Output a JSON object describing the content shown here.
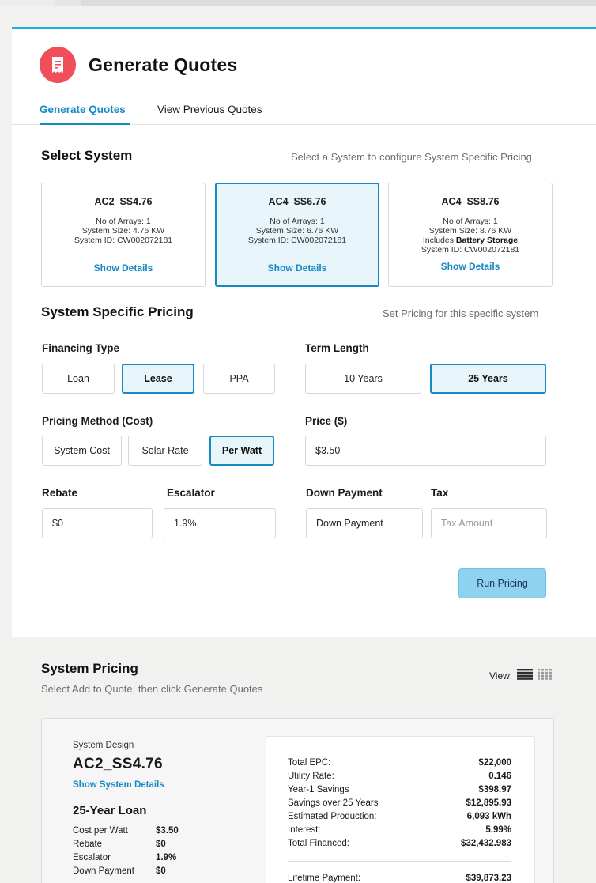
{
  "colors": {
    "accent": "#1589c4",
    "header_icon_bg": "#ef4e5a",
    "selected_bg": "#e8f6fb",
    "run_button_bg": "#8fd2f0"
  },
  "header": {
    "title": "Generate Quotes",
    "icon": "receipt-icon"
  },
  "tabs": [
    {
      "label": "Generate Quotes",
      "active": true
    },
    {
      "label": "View Previous Quotes",
      "active": false
    }
  ],
  "select_system": {
    "title": "Select System",
    "hint": "Select a System to configure System Specific Pricing",
    "systems": [
      {
        "name": "AC2_SS4.76",
        "arrays": "No of Arrays: 1",
        "size": "System Size: 4.76 KW",
        "battery_prefix": "",
        "battery_bold": "",
        "id": "System ID: CW002072181",
        "details": "Show Details",
        "selected": false
      },
      {
        "name": "AC4_SS6.76",
        "arrays": "No of Arrays: 1",
        "size": "System Size: 6.76 KW",
        "battery_prefix": "",
        "battery_bold": "",
        "id": "System ID: CW002072181",
        "details": "Show Details",
        "selected": true
      },
      {
        "name": "AC4_SS8.76",
        "arrays": "No of Arrays: 1",
        "size": "System Size: 8.76 KW",
        "battery_prefix": "Includes",
        "battery_bold": "Battery Storage",
        "id": "System ID: CW002072181",
        "details": "Show Details",
        "selected": false
      }
    ]
  },
  "pricing": {
    "title": "System Specific Pricing",
    "hint": "Set Pricing for this specific system",
    "financing_label": "Financing Type",
    "financing_options": [
      "Loan",
      "Lease",
      "PPA"
    ],
    "financing_selected": "Lease",
    "term_label": "Term Length",
    "term_options": [
      "10 Years",
      "25 Years"
    ],
    "term_selected": "25 Years",
    "method_label": "Pricing Method (Cost)",
    "method_options": [
      "System Cost",
      "Solar Rate",
      "Per Watt"
    ],
    "method_selected": "Per Watt",
    "price_label": "Price ($)",
    "price_value": "$3.50",
    "rebate_label": "Rebate",
    "rebate_value": "$0",
    "escalator_label": "Escalator",
    "escalator_value": "1.9%",
    "down_payment_label": "Down Payment",
    "down_payment_value": "Down Payment",
    "tax_label": "Tax",
    "tax_placeholder": "Tax Amount",
    "run_button": "Run Pricing"
  },
  "system_pricing": {
    "title": "System Pricing",
    "subtitle": "Select Add to Quote, then click Generate Quotes",
    "view_label": "View:",
    "result": {
      "design_label": "System Design",
      "design_name": "AC2_SS4.76",
      "details_link": "Show System Details",
      "loan_title": "25-Year Loan",
      "params": [
        {
          "k": "Cost per Watt",
          "v": "$3.50"
        },
        {
          "k": "Rebate",
          "v": "$0"
        },
        {
          "k": "Escalator",
          "v": "1.9%"
        },
        {
          "k": "Down Payment",
          "v": "$0"
        }
      ],
      "metrics": [
        {
          "k": "Total EPC:",
          "v": "$22,000"
        },
        {
          "k": "Utility Rate:",
          "v": "0.146"
        },
        {
          "k": "Year-1 Savings",
          "v": "$398.97"
        },
        {
          "k": "Savings over 25 Years",
          "v": "$12,895.93"
        },
        {
          "k": "Estimated Production:",
          "v": "6,093 kWh"
        },
        {
          "k": "Interest:",
          "v": "5.99%"
        },
        {
          "k": "Total Financed:",
          "v": "$32,432.983"
        }
      ],
      "lifetime": {
        "k": "Lifetime Payment:",
        "v": "$39,873.23"
      }
    }
  }
}
